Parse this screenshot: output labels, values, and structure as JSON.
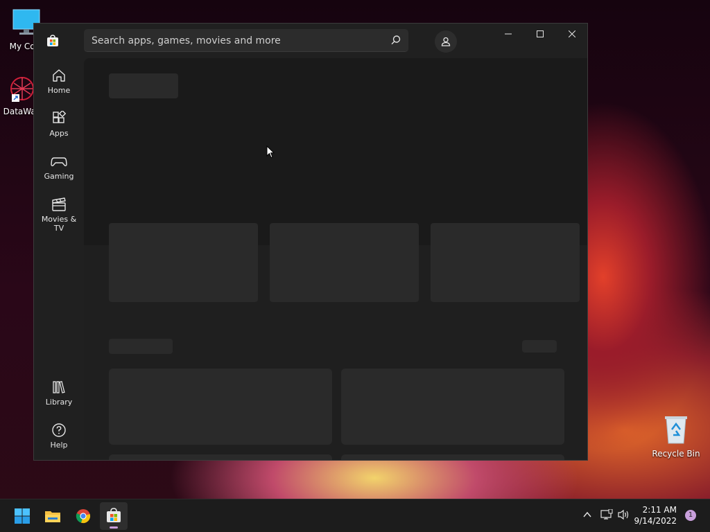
{
  "desktop": {
    "icons": [
      {
        "label": "My Com",
        "icon": "monitor-icon"
      },
      {
        "label": "DataWag",
        "icon": "datawag-app-icon"
      },
      {
        "label": "Recycle Bin",
        "icon": "recycle-bin-icon"
      }
    ]
  },
  "window": {
    "app_icon": "microsoft-store-icon",
    "search": {
      "placeholder": "Search apps, games, movies and more",
      "value": ""
    },
    "account_icon": "person-icon",
    "controls": [
      "minimize-icon",
      "maximize-icon",
      "close-icon"
    ]
  },
  "sidebar": {
    "items": [
      {
        "label": "Home",
        "icon": "home-icon"
      },
      {
        "label": "Apps",
        "icon": "apps-icon"
      },
      {
        "label": "Gaming",
        "icon": "gamepad-icon"
      },
      {
        "label": "Movies & TV",
        "icon": "clapperboard-icon"
      }
    ],
    "bottom_items": [
      {
        "label": "Library",
        "icon": "library-icon"
      },
      {
        "label": "Help",
        "icon": "help-icon"
      }
    ]
  },
  "content": {
    "state": "loading-placeholders"
  },
  "taskbar": {
    "apps": [
      {
        "name": "start-button",
        "icon": "windows-logo-icon"
      },
      {
        "name": "file-explorer",
        "icon": "folder-icon"
      },
      {
        "name": "chrome",
        "icon": "chrome-icon"
      },
      {
        "name": "microsoft-store",
        "icon": "store-icon",
        "active": true
      }
    ],
    "tray": {
      "icons": [
        "chevron-up-icon",
        "network-icon",
        "volume-icon"
      ]
    },
    "time": "2:11 AM",
    "date": "9/14/2022",
    "notification_count": "1"
  },
  "colors": {
    "accent": "#c9a0dc",
    "window_bg": "#202020",
    "taskbar_bg": "#1c1c1c"
  }
}
